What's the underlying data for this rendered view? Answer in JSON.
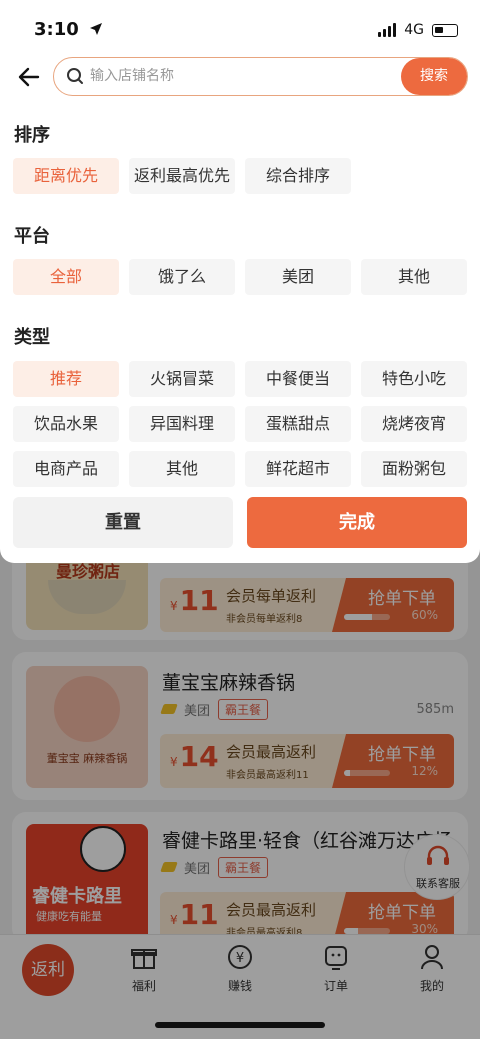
{
  "status_bar": {
    "time": "3:10",
    "network": "4G"
  },
  "search": {
    "placeholder": "输入店铺名称",
    "button": "搜索"
  },
  "filters": {
    "sort": {
      "title": "排序",
      "options": [
        "距离优先",
        "返利最高优先",
        "综合排序"
      ],
      "selected": 0
    },
    "platform": {
      "title": "平台",
      "options": [
        "全部",
        "饿了么",
        "美团",
        "其他"
      ],
      "selected": 0
    },
    "category": {
      "title": "类型",
      "options": [
        "推荐",
        "火锅冒菜",
        "中餐便当",
        "特色小吃",
        "饮品水果",
        "异国料理",
        "蛋糕甜点",
        "烧烤夜宵",
        "电商产品",
        "其他",
        "鲜花超市",
        "面粉粥包"
      ],
      "selected": 0
    }
  },
  "actions": {
    "reset": "重置",
    "done": "完成"
  },
  "stores": [
    {
      "thumb_text": "曼珍粥店",
      "amount_prefix": "¥",
      "amount": "11",
      "rebate_title": "会员每单返利",
      "rebate_sub": "非会员每单返利8",
      "grab": "抢单下单",
      "progress": 0.6,
      "progress_label": "60%"
    },
    {
      "name": "董宝宝麻辣香锅",
      "thumb_text": "董宝宝 麻辣香锅",
      "platform": "美团",
      "badge": "霸王餐",
      "distance": "585m",
      "amount_prefix": "¥",
      "amount": "14",
      "rebate_title": "会员最高返利",
      "rebate_sub": "非会员最高返利11",
      "grab": "抢单下单",
      "progress": 0.12,
      "progress_label": "12%"
    },
    {
      "name": "睿健卡路里·轻食（红谷滩万达广场",
      "thumb_text": "睿健卡路里",
      "thumb_sub": "健康吃有能量",
      "platform": "美团",
      "badge": "霸王餐",
      "amount_prefix": "¥",
      "amount": "11",
      "rebate_title": "会员最高返利",
      "rebate_sub": "非会员最高返利8",
      "grab": "抢单下单",
      "progress": 0.3,
      "progress_label": "30%"
    }
  ],
  "float_service": "联系客服",
  "tabbar": {
    "home": "返利",
    "items": [
      "福利",
      "赚钱",
      "订单",
      "我的"
    ]
  },
  "colors": {
    "accent": "#ED6A3F",
    "chip_active_bg": "#FDEEE6",
    "chip_bg": "#F5F5F5"
  }
}
